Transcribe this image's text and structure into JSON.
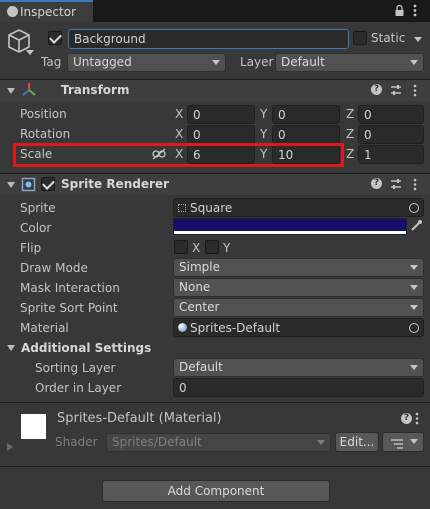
{
  "tab": {
    "label": "Inspector"
  },
  "gameobject": {
    "name": "Background",
    "static_label": "Static",
    "tag_label": "Tag",
    "tag_value": "Untagged",
    "layer_label": "Layer",
    "layer_value": "Default"
  },
  "transform": {
    "title": "Transform",
    "rows": [
      {
        "label": "Position",
        "x": "0",
        "y": "0",
        "z": "0"
      },
      {
        "label": "Rotation",
        "x": "0",
        "y": "0",
        "z": "0"
      },
      {
        "label": "Scale",
        "x": "6",
        "y": "10",
        "z": "1"
      }
    ],
    "axis_x": "X",
    "axis_y": "Y",
    "axis_z": "Z"
  },
  "sprite_renderer": {
    "title": "Sprite Renderer",
    "sprite_label": "Sprite",
    "sprite_value": "Square",
    "color_label": "Color",
    "color_value": "#14106a",
    "flip_label": "Flip",
    "flip_x": "X",
    "flip_y": "Y",
    "draw_mode_label": "Draw Mode",
    "draw_mode_value": "Simple",
    "mask_label": "Mask Interaction",
    "mask_value": "None",
    "sort_point_label": "Sprite Sort Point",
    "sort_point_value": "Center",
    "material_label": "Material",
    "material_value": "Sprites-Default",
    "additional_title": "Additional Settings",
    "sorting_layer_label": "Sorting Layer",
    "sorting_layer_value": "Default",
    "order_label": "Order in Layer",
    "order_value": "0"
  },
  "material": {
    "title": "Sprites-Default (Material)",
    "shader_label": "Shader",
    "shader_value": "Sprites/Default",
    "edit_label": "Edit..."
  },
  "add_component_label": "Add Component",
  "colors": {
    "highlight": "#e0171f",
    "accent": "#3a79bb"
  }
}
